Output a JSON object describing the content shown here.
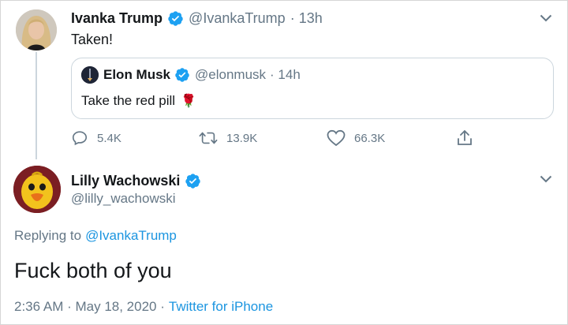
{
  "parent_tweet": {
    "author_name": "Ivanka Trump",
    "handle": "@IvankaTrump",
    "time": "· 13h",
    "text": "Taken!",
    "avatar_icon": "profile-photo-woman",
    "quoted_tweet": {
      "author_name": "Elon Musk",
      "handle": "@elonmusk",
      "time": "· 14h",
      "text": "Take the red pill",
      "emoji": "🌹",
      "avatar_icon": "profile-photo-dark"
    },
    "actions": {
      "reply_count": "5.4K",
      "retweet_count": "13.9K",
      "like_count": "66.3K"
    }
  },
  "reply_tweet": {
    "author_name": "Lilly Wachowski",
    "handle": "@lilly_wachowski",
    "replying_prefix": "Replying to",
    "replying_to": "@IvankaTrump",
    "text": "Fuck both of you",
    "timestamp": "2:36 AM · May 18, 2020 ·",
    "source": "Twitter for iPhone",
    "avatar_icon": "duck-mask-avatar"
  },
  "colors": {
    "verified_blue": "#1da1f2",
    "link_blue": "#1b95e0",
    "muted_gray": "#657786",
    "border_gray": "#ccd6dd"
  }
}
